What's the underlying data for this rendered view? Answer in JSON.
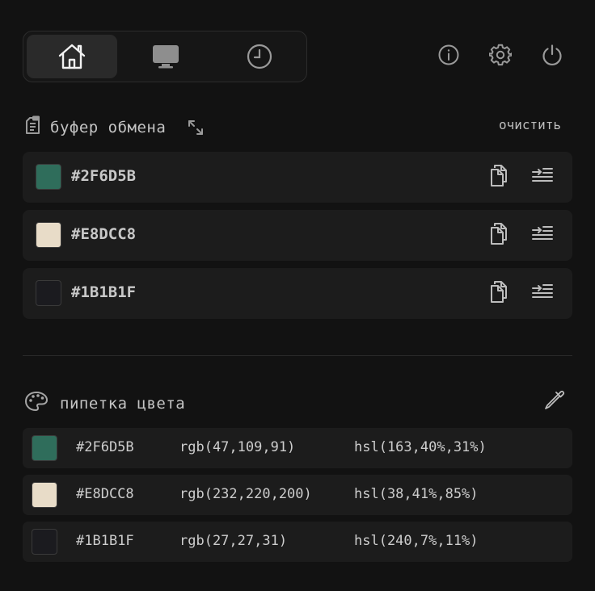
{
  "nav": {
    "tabs": [
      {
        "icon": "home-icon"
      },
      {
        "icon": "monitor-icon"
      },
      {
        "icon": "clock-icon"
      }
    ],
    "actions": [
      "info-icon",
      "gear-icon",
      "power-icon"
    ]
  },
  "clipboard": {
    "title": "буфер обмена",
    "clear_label": "очистить",
    "items": [
      {
        "hex": "#2F6D5B",
        "color": "#2F6D5B"
      },
      {
        "hex": "#E8DCC8",
        "color": "#E8DCC8"
      },
      {
        "hex": "#1B1B1F",
        "color": "#1B1B1F"
      }
    ]
  },
  "picker": {
    "title": "пипетка цвета",
    "items": [
      {
        "hex": "#2F6D5B",
        "rgb": "rgb(47,109,91)",
        "hsl": "hsl(163,40%,31%)",
        "color": "#2F6D5B"
      },
      {
        "hex": "#E8DCC8",
        "rgb": "rgb(232,220,200)",
        "hsl": "hsl(38,41%,85%)",
        "color": "#E8DCC8"
      },
      {
        "hex": "#1B1B1F",
        "rgb": "rgb(27,27,31)",
        "hsl": "hsl(240,7%,11%)",
        "color": "#1B1B1F"
      }
    ]
  }
}
